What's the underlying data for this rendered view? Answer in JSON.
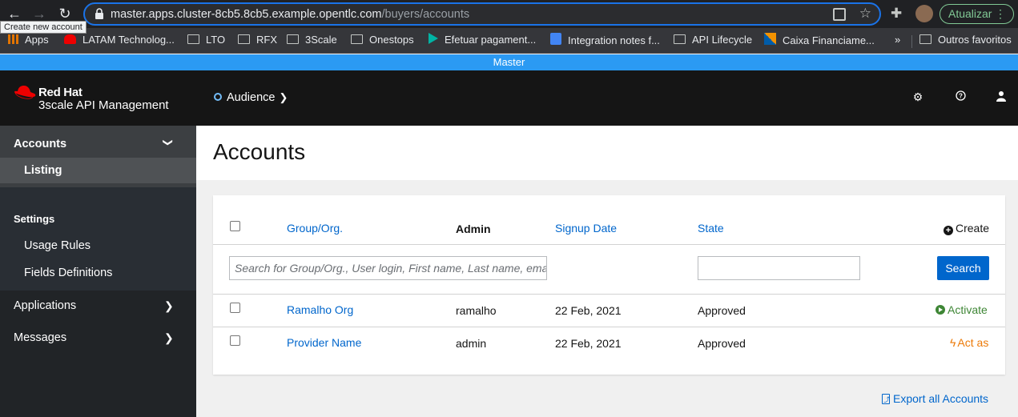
{
  "browser": {
    "url_host": "master.apps.cluster-8cb5.8cb5.example.opentlc.com",
    "url_path": "/buyers/accounts",
    "tooltip": "Create new account",
    "update_label": "Atualizar",
    "bookmarks": [
      "Apps",
      "LATAM Technolog...",
      "LTO",
      "RFX",
      "3Scale",
      "Onestops",
      "Efetuar pagament...",
      "Integration notes f...",
      "API Lifecycle",
      "Caixa Financiame...",
      "»",
      "Outros favoritos"
    ]
  },
  "masterbar": {
    "label": "Master"
  },
  "header": {
    "brand_line1": "Red Hat",
    "brand_line2": "3scale API Management",
    "context_label": "Audience"
  },
  "sidebar": {
    "accounts_label": "Accounts",
    "listing_label": "Listing",
    "settings_label": "Settings",
    "usage_rules_label": "Usage Rules",
    "fields_definitions_label": "Fields Definitions",
    "applications_label": "Applications",
    "messages_label": "Messages"
  },
  "main": {
    "title": "Accounts",
    "table": {
      "headers": {
        "group": "Group/Org.",
        "admin": "Admin",
        "signup": "Signup Date",
        "state": "State",
        "create": "Create"
      },
      "search_placeholder": "Search for Group/Org., User login, First name, Last name, email",
      "search_button": "Search",
      "rows": [
        {
          "group": "Ramalho Org",
          "admin": "ramalho",
          "signup": "22 Feb, 2021",
          "state": "Approved",
          "action": "Activate"
        },
        {
          "group": "Provider Name",
          "admin": "admin",
          "signup": "22 Feb, 2021",
          "state": "Approved",
          "action": "Act as"
        }
      ]
    },
    "export_label": "Export all Accounts"
  },
  "colors": {
    "accent": "#0066cc",
    "masterbar": "#2b9af3",
    "activate": "#3e8635",
    "act_as": "#ec7a08",
    "header_bg": "#151515"
  }
}
